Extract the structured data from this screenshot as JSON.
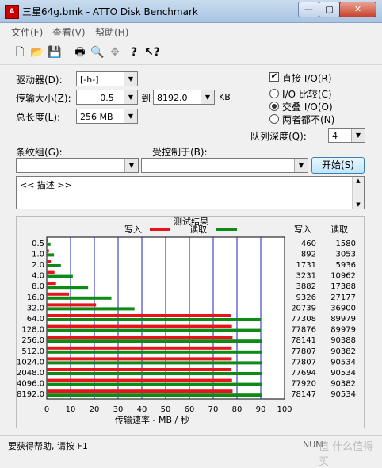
{
  "window": {
    "title": "三星64g.bmk - ATTO Disk Benchmark",
    "icon": "atto-app-icon",
    "buttons": {
      "minimize": "—",
      "maximize": "▢",
      "close": "✕"
    }
  },
  "menu": [
    "文件(F)",
    "查看(V)",
    "帮助(H)"
  ],
  "toolbar_icons": [
    "new-file-icon",
    "open-folder-icon",
    "save-icon",
    "print-icon",
    "print-preview-icon",
    "move-icon",
    "help-icon",
    "context-help-icon"
  ],
  "settings": {
    "drive_label": "驱动器(D):",
    "drive_value": "[-h-]",
    "transfer_label": "传输大小(Z):",
    "transfer_from": "0.5",
    "transfer_to_label": "到",
    "transfer_to": "8192.0",
    "transfer_unit": "KB",
    "total_label": "总长度(L):",
    "total_value": "256 MB",
    "direct_io_label": "直接 I/O(R)",
    "direct_io_checked": true,
    "io_compare_label": "I/O 比较(C)",
    "overlap_io_label": "交叠 I/O(O)",
    "neither_label": "两者都不(N)",
    "selected_mode": "overlap",
    "queue_label": "队列深度(Q):",
    "queue_value": "4",
    "stripe_label": "条纹组(G):",
    "stripe_value": "",
    "controlled_label": "受控制于(B):",
    "controlled_value": "",
    "start_button": "开始(S)",
    "description": "<< 描述 >>"
  },
  "chart_data": {
    "type": "bar",
    "title": "测试结果",
    "legend": {
      "write": "写入",
      "read": "读取"
    },
    "xlabel": "传输速率 - MB / 秒",
    "xlim": [
      0,
      100
    ],
    "xticks": [
      "0",
      "10",
      "20",
      "30",
      "40",
      "50",
      "60",
      "70",
      "80",
      "90",
      "100"
    ],
    "categories": [
      "0.5",
      "1.0",
      "2.0",
      "4.0",
      "8.0",
      "16.0",
      "32.0",
      "64.0",
      "128.0",
      "256.0",
      "512.0",
      "1024.0",
      "2048.0",
      "4096.0",
      "8192.0"
    ],
    "col_write": "写入",
    "col_read": "读取",
    "write_kb": [
      "460",
      "892",
      "1731",
      "3231",
      "3882",
      "9326",
      "20739",
      "77308",
      "77876",
      "78141",
      "77807",
      "77807",
      "77694",
      "77920",
      "78147"
    ],
    "read_kb": [
      "1580",
      "3053",
      "5936",
      "10962",
      "17388",
      "27177",
      "36900",
      "89979",
      "89979",
      "90388",
      "90382",
      "90534",
      "90534",
      "90382",
      "90534"
    ],
    "series": [
      {
        "name": "写入",
        "color": "#e8131b",
        "values": [
          0.46,
          0.89,
          1.73,
          3.23,
          3.88,
          9.33,
          20.74,
          77.31,
          77.88,
          78.14,
          77.81,
          77.81,
          77.69,
          77.92,
          78.15
        ]
      },
      {
        "name": "读取",
        "color": "#0e8a16",
        "values": [
          1.58,
          3.05,
          5.94,
          10.96,
          17.39,
          27.18,
          36.9,
          89.98,
          89.98,
          90.39,
          90.38,
          90.53,
          90.53,
          90.38,
          90.53
        ]
      }
    ],
    "grid_color": "#1f1fbf"
  },
  "status": {
    "help": "要获得帮助, 请按 F1",
    "num": "NUM"
  },
  "watermark": "值 什么值得买"
}
